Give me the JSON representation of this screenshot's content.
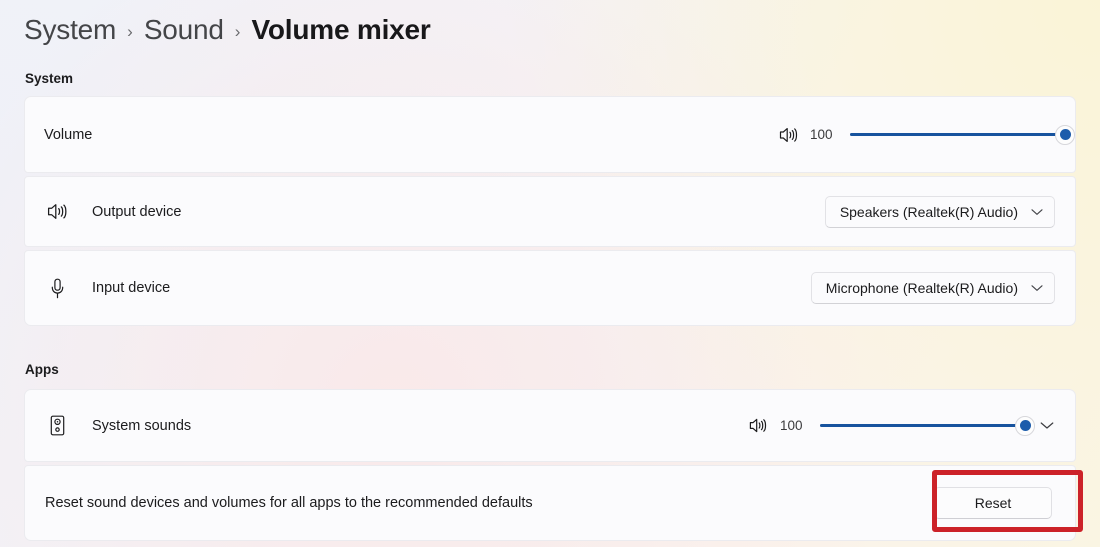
{
  "breadcrumb": {
    "items": [
      "System",
      "Sound"
    ],
    "separator": "›",
    "current": "Volume mixer"
  },
  "sections": {
    "system_label": "System",
    "apps_label": "Apps"
  },
  "system": {
    "volume": {
      "label": "Volume",
      "icon": "speaker-volume-icon",
      "value": "100",
      "percent": 100
    },
    "output_device": {
      "label": "Output device",
      "icon": "speaker-volume-icon",
      "selected": "Speakers (Realtek(R) Audio)",
      "chevron": "chevron-down-icon"
    },
    "input_device": {
      "label": "Input device",
      "icon": "microphone-icon",
      "selected": "Microphone (Realtek(R) Audio)",
      "chevron": "chevron-down-icon"
    }
  },
  "apps": {
    "system_sounds": {
      "label": "System sounds",
      "icon": "speaker-box-icon",
      "slider_icon": "speaker-volume-icon",
      "value": "100",
      "percent": 100,
      "expander": "chevron-down-icon"
    },
    "reset": {
      "description": "Reset sound devices and volumes for all apps to the recommended defaults",
      "button_label": "Reset"
    }
  },
  "colors": {
    "accent_blue": "#17539e",
    "thumb_blue": "#1d5cab",
    "annotation_red": "#cc2229",
    "card_bg": "#fbfbfd",
    "track_gray": "#d0d0d4"
  },
  "annotation": {
    "name": "reset-button-highlight",
    "shape": "rectangle",
    "color": "#cc2229"
  }
}
